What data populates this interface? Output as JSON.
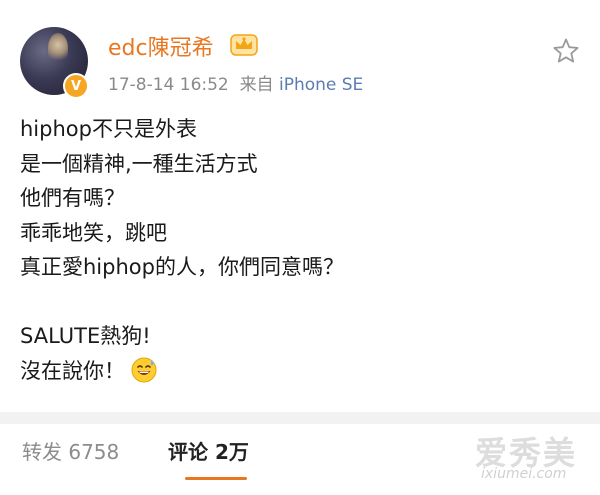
{
  "post": {
    "username": "edc陳冠希",
    "verified_badge": "V",
    "timestamp": "17-8-14 16:52",
    "source_prefix": "来自",
    "source": "iPhone SE",
    "lines": [
      "hiphop不只是外表",
      "是一個精神,一種生活方式",
      "他們有嗎？",
      "乖乖地笑，跳吧",
      "真正愛hiphop的人，你們同意嗎？",
      "",
      "SALUTE熱狗!",
      "沒在說你！"
    ],
    "icons": [
      "crown-badge-icon",
      "star-icon",
      "sweat-smile-emoji-icon",
      "verified-badge-icon"
    ]
  },
  "tabs": {
    "repost": "转发 6758",
    "comment": "评论 2万"
  },
  "watermark": {
    "logo": "爱秀美",
    "url": "ixiumei.com"
  },
  "colors": {
    "username": "#e87722",
    "source": "#5b7db1",
    "meta": "#8a8a8a",
    "accent": "#e87722",
    "divider": "#f2f2f2"
  }
}
